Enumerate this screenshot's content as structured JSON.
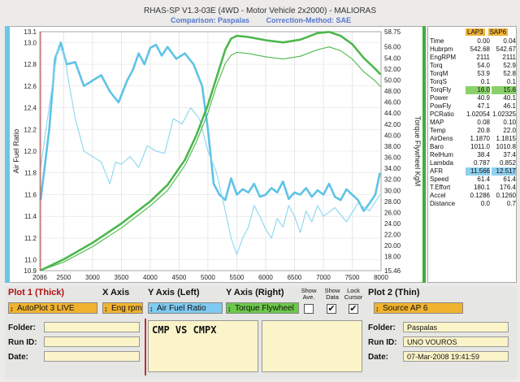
{
  "header": {
    "title": "RHAS-SP V1.3-03E  (4WD - Motor Vehicle 2x2000) - MALIORAS",
    "comparison": "Comparison: Paspalas",
    "correction": "Correction-Method: SAE"
  },
  "stats": {
    "col1": "LAP3",
    "col2": "SAP6",
    "rows": [
      {
        "name": "Time",
        "v1": "0.00",
        "v2": "0.04"
      },
      {
        "name": "Hubrpm",
        "v1": "542.68",
        "v2": "542.67"
      },
      {
        "name": "EngRPM",
        "v1": "2111",
        "v2": "2111"
      },
      {
        "name": "Torq",
        "v1": "54.0",
        "v2": "52.9"
      },
      {
        "name": "TorqM",
        "v1": "53.9",
        "v2": "52.8"
      },
      {
        "name": "TorqS",
        "v1": "0.1",
        "v2": "0.1"
      },
      {
        "name": "TorqFly",
        "v1": "16.0",
        "v2": "15.6",
        "hl": "green"
      },
      {
        "name": "Power",
        "v1": "40.9",
        "v2": "40.1"
      },
      {
        "name": "PowFly",
        "v1": "47.1",
        "v2": "46.1"
      },
      {
        "name": "PCRatio",
        "v1": "1.02054",
        "v2": "1.02325"
      },
      {
        "name": "MAP",
        "v1": "0.08",
        "v2": "0.10"
      },
      {
        "name": "Temp",
        "v1": "20.8",
        "v2": "22.0"
      },
      {
        "name": "AirDens",
        "v1": "1.1870",
        "v2": "1.1815"
      },
      {
        "name": "Baro",
        "v1": "1011.0",
        "v2": "1010.8"
      },
      {
        "name": "RelHum",
        "v1": "38.4",
        "v2": "37.4"
      },
      {
        "name": "Lambda",
        "v1": "0.787",
        "v2": "0.852"
      },
      {
        "name": "AFR",
        "v1": "11.566",
        "v2": "12.517",
        "hl": "blue"
      },
      {
        "name": "Speed",
        "v1": "61.4",
        "v2": "61.4"
      },
      {
        "name": "T.Effort",
        "v1": "180.1",
        "v2": "176.4"
      },
      {
        "name": "Accel",
        "v1": "0.1286",
        "v2": "0.1260"
      },
      {
        "name": "Distance",
        "v1": "0.0",
        "v2": "0.7"
      }
    ]
  },
  "controls": {
    "plot1_label": "Plot 1 (Thick)",
    "xaxis_label": "X Axis",
    "yleft_label": "Y Axis (Left)",
    "yright_label": "Y Axis (Right)",
    "plot2_label": "Plot 2 (Thin)",
    "show_ave": "Show Ave.",
    "show_data": "Show Data",
    "lock_cursor": "Lock Cursor",
    "plot1_value": "AutoPlot 3 LIVE",
    "xaxis_value": "Eng rpm",
    "yleft_value": "Air Fuel Ratio",
    "yright_value": "Torque Flywheel",
    "plot2_value": "Source AP 6",
    "show_data_check": "✔",
    "lock_cursor_check": "✔"
  },
  "info_left": {
    "folder_label": "Folder:",
    "runid_label": "Run ID:",
    "date_label": "Date:",
    "comment": "CMP VS CMPX"
  },
  "info_right": {
    "folder_label": "Folder:",
    "runid_label": "Run ID:",
    "date_label": "Date:",
    "folder": "Paspalas",
    "runid": "UNO VOUROS",
    "date": "07-Mar-2008  19:41:59"
  },
  "chart_data": {
    "type": "line",
    "xlabel": "",
    "ylabel": "Air Fuel Ratio",
    "y2label": "Torque Flywheel KgM",
    "xlim": [
      2086,
      8000
    ],
    "ylim": [
      10.9,
      13.1
    ],
    "y2lim": [
      15.46,
      58.75
    ],
    "xticks": [
      "2086",
      "2500",
      "3000",
      "3500",
      "4000",
      "4500",
      "5000",
      "5500",
      "6000",
      "6500",
      "7000",
      "7500",
      "8000"
    ],
    "yticks": [
      "10.9",
      "11.0",
      "11.2",
      "11.4",
      "11.6",
      "11.8",
      "12.0",
      "12.2",
      "12.4",
      "12.6",
      "12.8",
      "13.0",
      "13.1"
    ],
    "y2ticks": [
      "15.46",
      "18.00",
      "20.00",
      "22.00",
      "24.00",
      "26.00",
      "28.00",
      "30.00",
      "32.00",
      "34.00",
      "36.00",
      "38.00",
      "40.00",
      "42.00",
      "44.00",
      "46.00",
      "48.00",
      "50.00",
      "52.00",
      "54.00",
      "56.00",
      "58.75"
    ],
    "series": [
      {
        "name": "",
        "axis": "left",
        "style": "thick",
        "color": "#5ec3e6",
        "x": [
          2100,
          2250,
          2350,
          2450,
          2550,
          2700,
          2850,
          3000,
          3150,
          3300,
          3450,
          3600,
          3700,
          3800,
          3900,
          4000,
          4100,
          4200,
          4300,
          4450,
          4600,
          4750,
          4900,
          5000,
          5100,
          5200,
          5300,
          5400,
          5500,
          5600,
          5700,
          5800,
          5900,
          6000,
          6100,
          6200,
          6300,
          6400,
          6500,
          6600,
          6700,
          6800,
          6900,
          7000,
          7100,
          7200,
          7300,
          7400,
          7500,
          7600,
          7700,
          7800,
          7900,
          7980
        ],
        "y": [
          11.55,
          12.2,
          12.85,
          13.0,
          12.8,
          12.82,
          12.6,
          12.65,
          12.7,
          12.55,
          12.45,
          12.65,
          12.75,
          12.9,
          12.8,
          12.95,
          12.98,
          12.88,
          12.96,
          12.85,
          12.9,
          12.8,
          12.6,
          12.2,
          11.7,
          11.6,
          11.55,
          11.75,
          11.6,
          11.65,
          11.62,
          11.7,
          11.58,
          11.6,
          11.66,
          11.62,
          11.72,
          11.56,
          11.62,
          11.6,
          11.66,
          11.58,
          11.64,
          11.6,
          11.7,
          11.58,
          11.55,
          11.65,
          11.6,
          11.55,
          11.45,
          11.52,
          11.6,
          11.8
        ]
      },
      {
        "name": "",
        "axis": "left",
        "style": "thin",
        "color": "#8ad6ef",
        "x": [
          2100,
          2300,
          2400,
          2500,
          2600,
          2700,
          2850,
          3000,
          3150,
          3300,
          3400,
          3500,
          3650,
          3800,
          3950,
          4100,
          4250,
          4400,
          4550,
          4700,
          4850,
          5000,
          5150,
          5300,
          5400,
          5500,
          5600,
          5700,
          5800,
          5900,
          6000,
          6100,
          6200,
          6300,
          6400,
          6500,
          6600,
          6700,
          6800,
          6900,
          7000,
          7200,
          7400,
          7600,
          7800,
          7980
        ],
        "y": [
          11.85,
          12.6,
          12.95,
          12.92,
          12.6,
          12.3,
          12.0,
          11.95,
          11.9,
          11.7,
          11.9,
          11.88,
          11.95,
          11.85,
          12.05,
          12.0,
          11.98,
          12.3,
          12.25,
          12.4,
          12.3,
          12.0,
          11.8,
          11.45,
          11.2,
          11.05,
          11.2,
          11.3,
          11.5,
          11.4,
          11.28,
          11.2,
          11.38,
          11.3,
          11.5,
          11.4,
          11.25,
          11.45,
          11.35,
          11.5,
          11.4,
          11.48,
          11.35,
          11.52,
          11.45,
          11.6
        ]
      },
      {
        "name": "",
        "axis": "right",
        "style": "thick",
        "color": "#4cb84c",
        "x": [
          2100,
          2500,
          3000,
          3500,
          4000,
          4300,
          4600,
          4800,
          5000,
          5150,
          5300,
          5400,
          5500,
          5700,
          6000,
          6300,
          6600,
          6900,
          7100,
          7300,
          7500,
          7700,
          7900,
          7990
        ],
        "y": [
          15.5,
          17.5,
          20.5,
          24.0,
          28.0,
          31.0,
          35.5,
          40.0,
          45.5,
          50.5,
          55.5,
          57.5,
          58.0,
          57.8,
          57.2,
          56.8,
          57.3,
          58.5,
          58.7,
          58.0,
          56.5,
          54.0,
          52.0,
          51.0
        ]
      },
      {
        "name": "",
        "axis": "right",
        "style": "thin",
        "color": "#4cb84c",
        "x": [
          2100,
          2500,
          3000,
          3500,
          4000,
          4300,
          4600,
          4800,
          5000,
          5150,
          5300,
          5400,
          5500,
          5700,
          6000,
          6300,
          6600,
          6900,
          7100,
          7300,
          7500,
          7700,
          7900,
          7990
        ],
        "y": [
          15.5,
          17.0,
          19.8,
          23.2,
          27.2,
          30.0,
          34.5,
          38.8,
          44.0,
          49.0,
          53.0,
          54.5,
          55.0,
          54.8,
          54.2,
          53.8,
          54.3,
          55.5,
          56.0,
          55.3,
          53.8,
          51.5,
          49.8,
          48.8
        ]
      }
    ]
  }
}
